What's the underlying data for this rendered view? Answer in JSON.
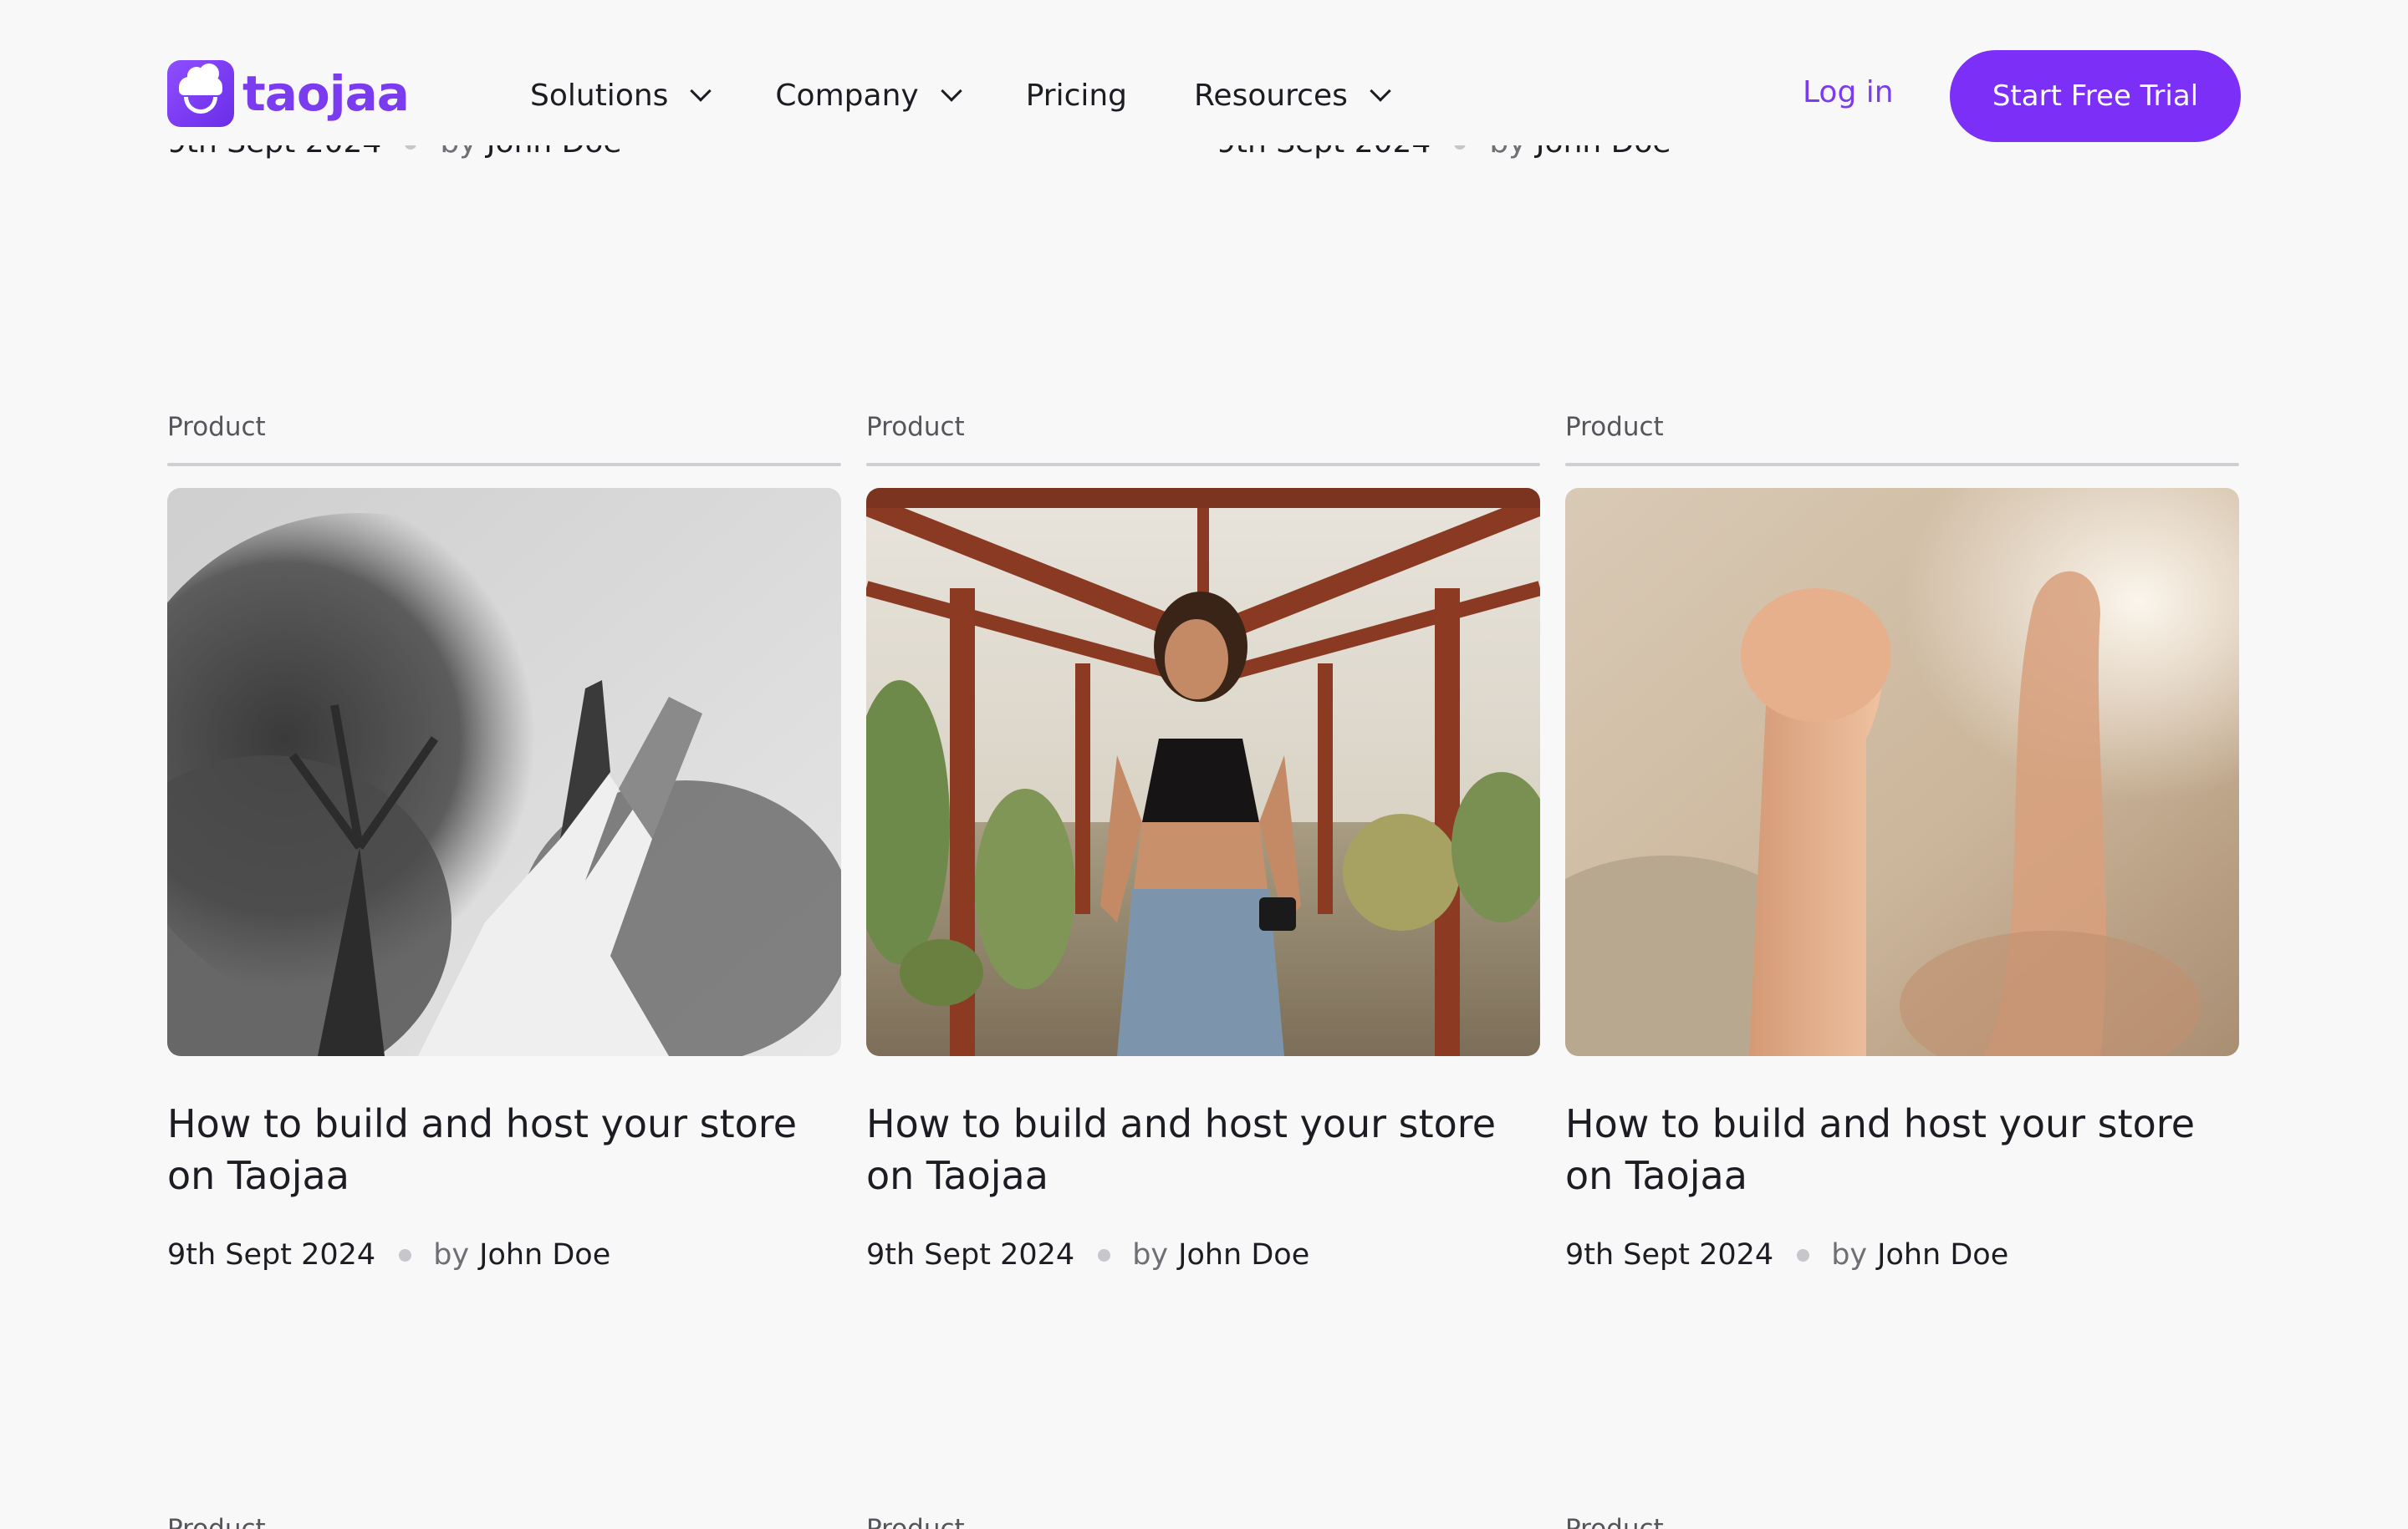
{
  "brand": {
    "name": "taojaa",
    "accent": "#7b2ff7"
  },
  "nav": {
    "items": [
      {
        "label": "Solutions",
        "has_dropdown": true
      },
      {
        "label": "Company",
        "has_dropdown": true
      },
      {
        "label": "Pricing",
        "has_dropdown": false
      },
      {
        "label": "Resources",
        "has_dropdown": true
      }
    ],
    "login_label": "Log in",
    "cta_label": "Start Free Trial"
  },
  "cards": [
    {
      "tag": "Product",
      "image": "black-and-white-hands-and-tree",
      "title": "How to build and host your store on Taojaa",
      "date": "9th Sept 2024",
      "by": "by",
      "author": "John Doe"
    },
    {
      "tag": "Product",
      "image": "woman-in-greenhouse-with-camera",
      "title": "How to build and host your store on Taojaa",
      "date": "9th Sept 2024",
      "by": "by",
      "author": "John Doe"
    },
    {
      "tag": "Product",
      "image": "baby-hand-raised",
      "title": "How to build and host your store on Taojaa",
      "date": "9th Sept 2024",
      "by": "by",
      "author": "John Doe"
    }
  ],
  "next_row_tags": [
    "Product",
    "Product",
    "Product"
  ]
}
